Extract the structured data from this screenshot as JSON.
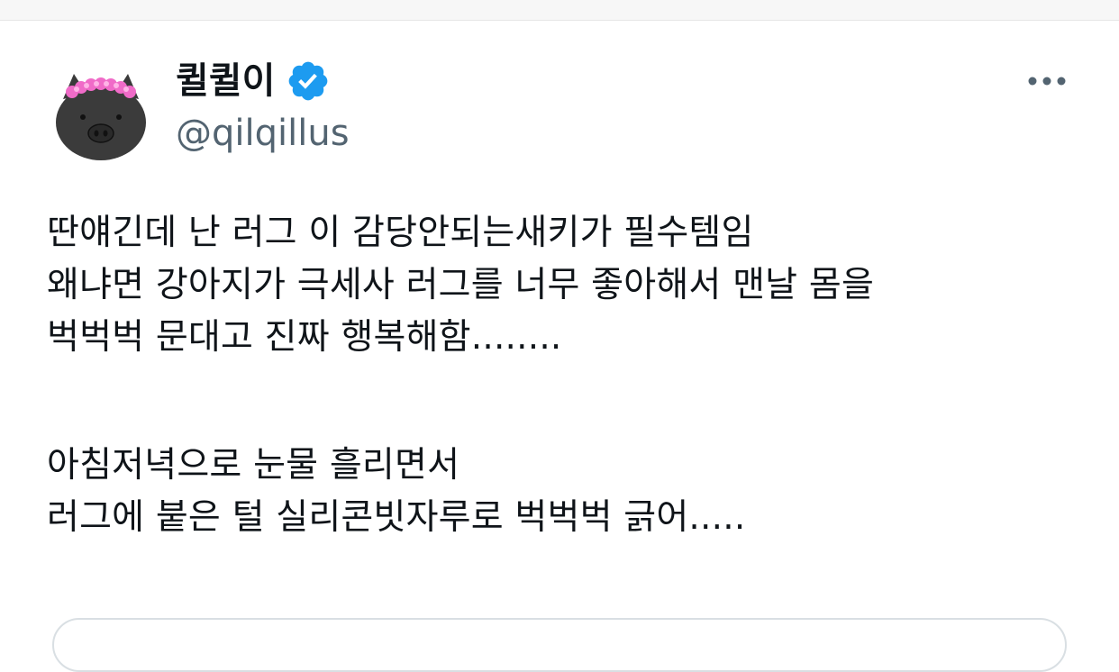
{
  "tweet": {
    "author": {
      "display_name": "퀼퀼이",
      "handle": "@qilqillus",
      "verified": true,
      "verified_color": "#1d9bf0",
      "avatar": "black-pig-with-pink-flower-crown"
    },
    "more_icon": "more-horizontal-icon",
    "lines": [
      "딴얘긴데 난 러그 이 감당안되는새키가 필수템임",
      "왜냐면 강아지가 극세사 러그를 너무 좋아해서 맨날 몸을",
      "벅벅벅 문대고 진짜 행복해함........",
      "",
      "아침저녁으로 눈물 흘리면서",
      "러그에 붙은 털 실리콘빗자루로 벅벅벅 긁어....."
    ]
  },
  "colors": {
    "text_primary": "#0f1419",
    "text_secondary": "#536471",
    "accent": "#1d9bf0"
  }
}
